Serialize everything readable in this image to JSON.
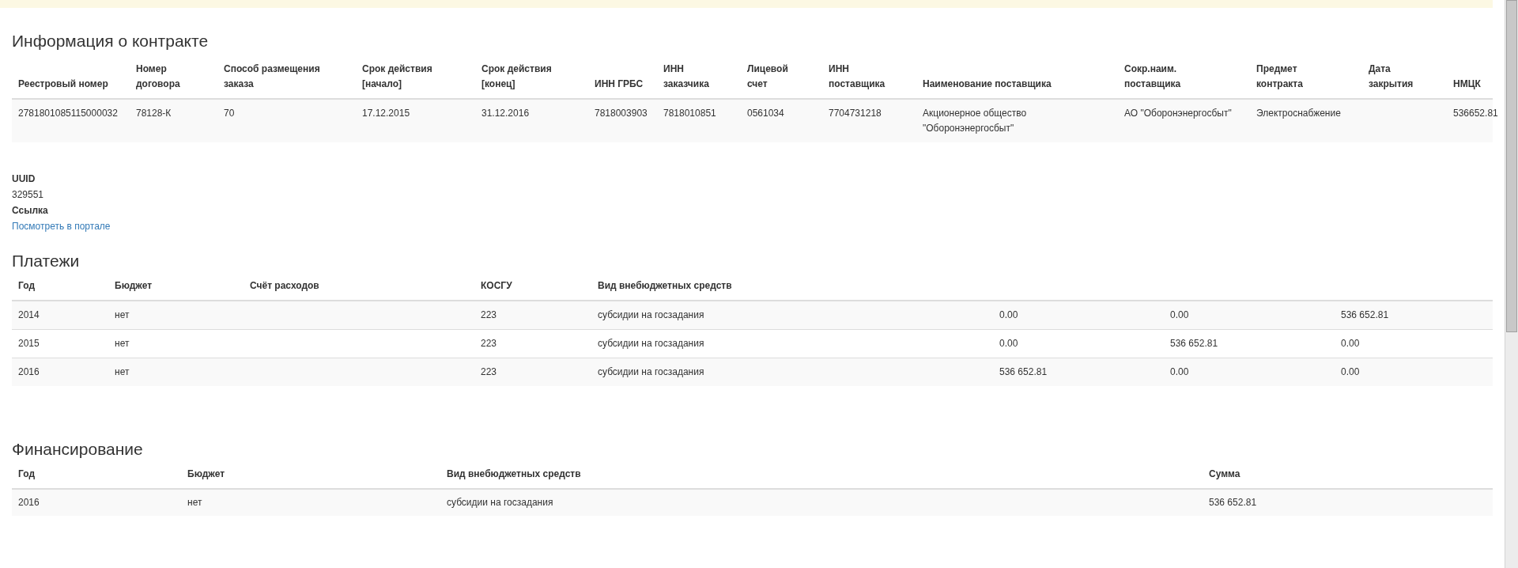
{
  "contract": {
    "title": "Информация о контракте",
    "columns": [
      "Реестровый номер",
      "Номер договора",
      "Способ размещения заказа",
      "Срок действия [начало]",
      "Срок действия [конец]",
      "ИНН ГРБС",
      "ИНН заказчика",
      "Лицевой счет",
      "ИНН поставщика",
      "Наименование поставщика",
      "Сокр.наим. поставщика",
      "Предмет контракта",
      "Дата закрытия",
      "НМЦК"
    ],
    "rows": [
      [
        "2781801085115000032",
        "78128-К",
        "70",
        "17.12.2015",
        "31.12.2016",
        "7818003903",
        "7818010851",
        "0561034",
        "7704731218",
        "Акционерное общество \"Оборонэнергосбыт\"",
        "АО \"Оборонэнергосбыт\"",
        "Электроснабжение",
        "",
        "536652.81"
      ]
    ]
  },
  "details": [
    {
      "label": "UUID",
      "value": "329551",
      "kind": "text"
    },
    {
      "label": "Ссылка",
      "value": "Посмотреть в портале",
      "kind": "link"
    }
  ],
  "payments": {
    "title": "Платежи",
    "columns": [
      "Год",
      "Бюджет",
      "Счёт расходов",
      "КОСГУ",
      "Вид внебюджетных средств"
    ],
    "rows": [
      [
        "2014",
        "нет",
        "",
        "223",
        "субсидии на госзадания",
        "0.00",
        "0.00",
        "536 652.81"
      ],
      [
        "2015",
        "нет",
        "",
        "223",
        "субсидии на госзадания",
        "0.00",
        "536 652.81",
        "0.00"
      ],
      [
        "2016",
        "нет",
        "",
        "223",
        "субсидии на госзадания",
        "536 652.81",
        "0.00",
        "0.00"
      ]
    ]
  },
  "financing": {
    "title": "Финансирование",
    "columns": [
      "Год",
      "Бюджет",
      "Вид внебюджетных средств",
      "Сумма"
    ],
    "rows": [
      [
        "2016",
        "нет",
        "субсидии на госзадания",
        "536 652.81"
      ]
    ]
  }
}
